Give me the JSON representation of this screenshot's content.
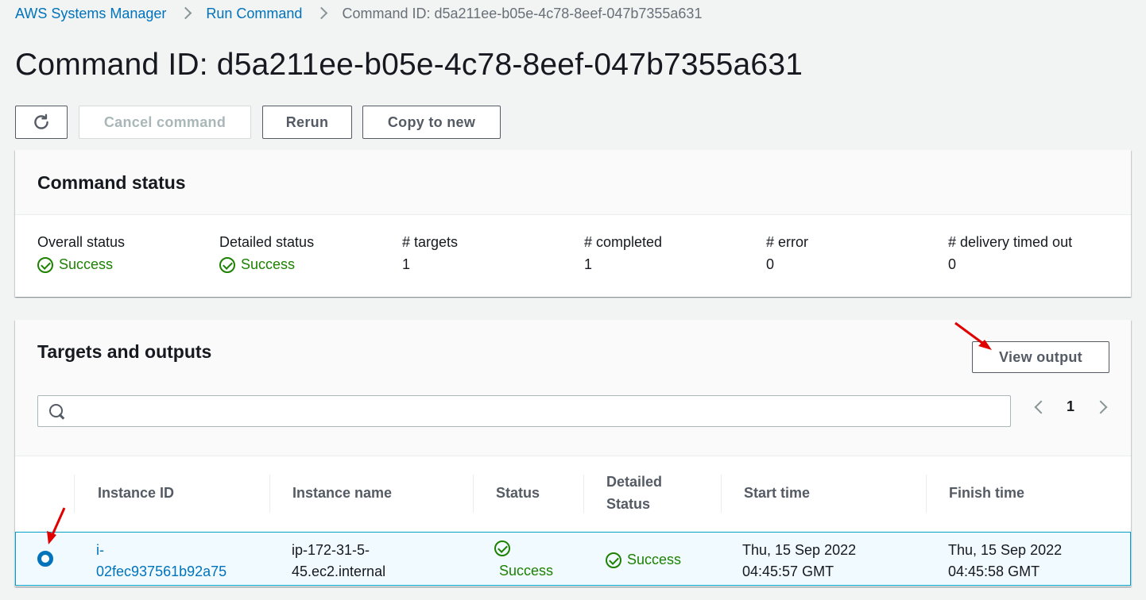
{
  "breadcrumb": {
    "items": [
      "AWS Systems Manager",
      "Run Command"
    ],
    "current": "Command ID: d5a211ee-b05e-4c78-8eef-047b7355a631"
  },
  "page_title": "Command ID: d5a211ee-b05e-4c78-8eef-047b7355a631",
  "toolbar": {
    "refresh_icon": "refresh-icon",
    "cancel_label": "Cancel command",
    "rerun_label": "Rerun",
    "copy_label": "Copy to new"
  },
  "command_status": {
    "heading": "Command status",
    "stats": [
      {
        "label": "Overall status",
        "value": "Success"
      },
      {
        "label": "Detailed status",
        "value": "Success"
      },
      {
        "label": "# targets",
        "value": "1"
      },
      {
        "label": "# completed",
        "value": "1"
      },
      {
        "label": "# error",
        "value": "0"
      },
      {
        "label": "# delivery timed out",
        "value": "0"
      }
    ]
  },
  "targets": {
    "heading": "Targets and outputs",
    "view_output_label": "View output",
    "search_placeholder": "",
    "page": "1",
    "columns": [
      "Instance ID",
      "Instance name",
      "Status",
      "Detailed",
      "Status",
      "Start time",
      "Finish time"
    ],
    "rows": [
      {
        "instance_id_1": "i-",
        "instance_id_2": "02fec937561b92a75",
        "name_1": "ip-172-31-5-",
        "name_2": "45.ec2.internal",
        "status": "Success",
        "detailed_status": "Success",
        "start_1": "Thu, 15 Sep 2022",
        "start_2": "04:45:57 GMT",
        "finish_1": "Thu, 15 Sep 2022",
        "finish_2": "04:45:58 GMT",
        "selected": true
      }
    ]
  },
  "colors": {
    "link": "#0073bb",
    "success": "#1d8102",
    "annotation_arrow": "#e00000"
  }
}
